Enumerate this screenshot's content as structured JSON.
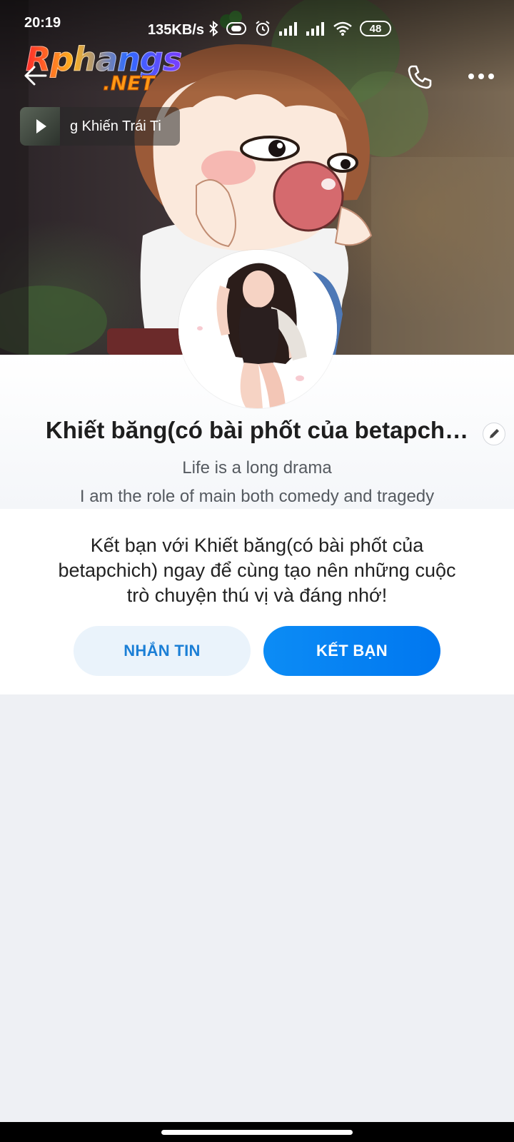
{
  "status_bar": {
    "time": "20:19",
    "network_speed": "135KB/s",
    "battery": "48"
  },
  "watermark": {
    "main": "Rphangs",
    "sub": ".NET"
  },
  "music": {
    "title": "g Khiến Trái Ti"
  },
  "profile": {
    "name": "Khiết băng(có bài phốt của betapch…",
    "bio_line1": "Life is a long drama",
    "bio_line2": "I am the role of main both comedy and tragedy"
  },
  "friend_card": {
    "message": "Kết bạn với Khiết băng(có bài phốt của betapchich) ngay để cùng tạo nên những cuộc trò chuyện thú vị và đáng nhớ!",
    "message_button": "NHẮN TIN",
    "add_friend_button": "KẾT BẠN"
  },
  "colors": {
    "accent": "#0a85f2",
    "secondary_button_bg": "#eaf3fb",
    "secondary_button_text": "#1b7fd6",
    "page_bg": "#eef0f4"
  },
  "icons": [
    "back-arrow-icon",
    "phone-icon",
    "more-icon",
    "play-icon",
    "edit-pencil-icon",
    "bluetooth-icon",
    "alarm-icon",
    "signal-icon",
    "wifi-icon",
    "battery-icon"
  ]
}
